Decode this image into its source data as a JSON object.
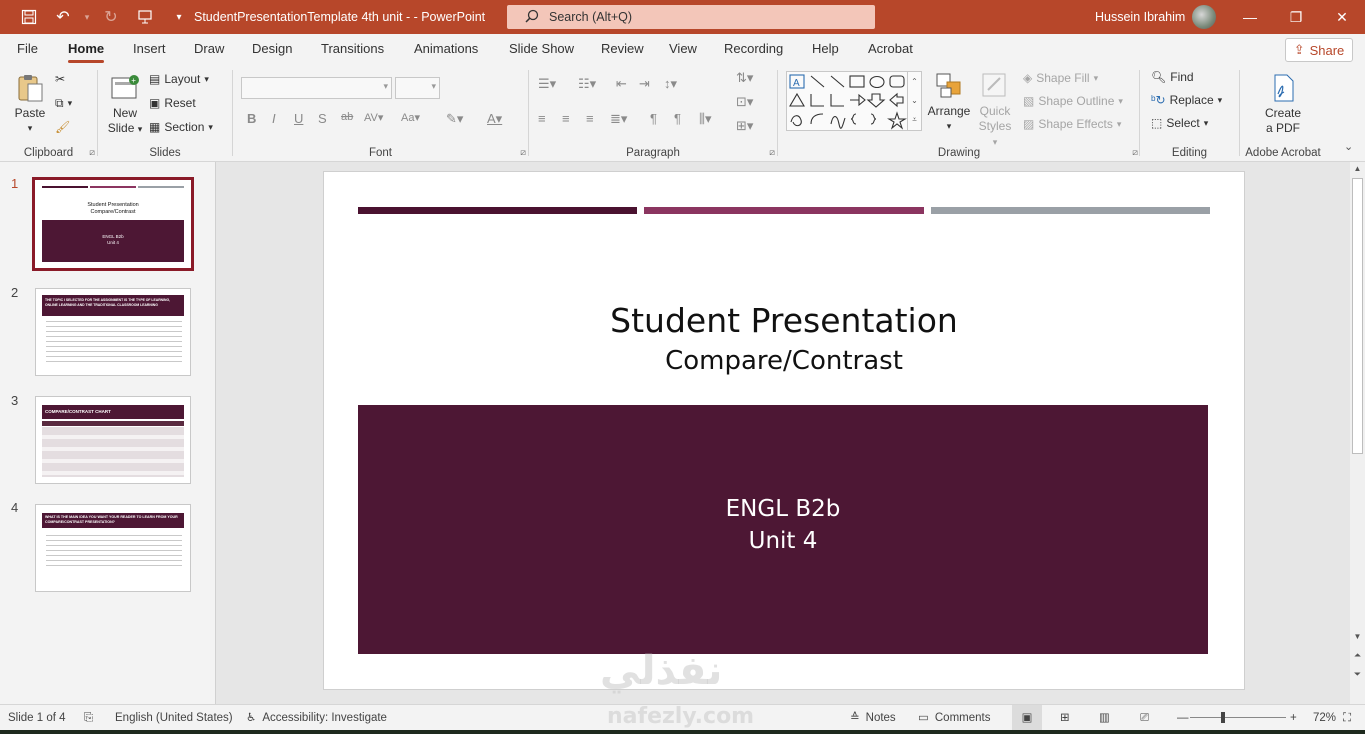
{
  "titlebar": {
    "doc_title": "StudentPresentationTemplate 4th unit -  -  PowerPoint",
    "search_placeholder": "Search (Alt+Q)",
    "user_name": "Hussein Ibrahim"
  },
  "tabs": [
    "File",
    "Home",
    "Insert",
    "Draw",
    "Design",
    "Transitions",
    "Animations",
    "Slide Show",
    "Review",
    "View",
    "Recording",
    "Help",
    "Acrobat"
  ],
  "share_label": "Share",
  "ribbon": {
    "clipboard": {
      "label": "Clipboard",
      "paste": "Paste"
    },
    "slides": {
      "label": "Slides",
      "new_slide_1": "New",
      "new_slide_2": "Slide",
      "layout": "Layout",
      "reset": "Reset",
      "section": "Section"
    },
    "font": {
      "label": "Font"
    },
    "paragraph": {
      "label": "Paragraph"
    },
    "drawing": {
      "label": "Drawing",
      "arrange": "Arrange",
      "quick_styles_1": "Quick",
      "quick_styles_2": "Styles",
      "shape_fill": "Shape Fill",
      "shape_outline": "Shape Outline",
      "shape_effects": "Shape Effects"
    },
    "editing": {
      "label": "Editing",
      "find": "Find",
      "replace": "Replace",
      "select": "Select"
    },
    "acrobat": {
      "label": "Adobe Acrobat",
      "create_pdf_1": "Create",
      "create_pdf_2": "a PDF"
    }
  },
  "thumbnails": [
    {
      "number": "1",
      "title": "Student Presentation",
      "subtitle": "Compare/Contrast",
      "box_line1": "ENGL B2b",
      "box_line2": "Unit 4"
    },
    {
      "number": "2",
      "header": "THE TOPIC I SELECTED FOR THE ASSIGNMENT IS THE TYPE OF LEARNING, ONLINE LEARNING AND THE TRADITIONAL CLASSROOM LEARNING"
    },
    {
      "number": "3",
      "header": "COMPARE/CONTRAST CHART"
    },
    {
      "number": "4",
      "header": "WHAT IS THE MAIN IDEA YOU WANT YOUR READER TO LEARN FROM YOUR COMPARE/CONTRAST PRESENTATION?"
    }
  ],
  "slide": {
    "title": "Student Presentation",
    "subtitle": "Compare/Contrast",
    "box_line1": "ENGL B2b",
    "box_line2": "Unit 4",
    "colors": {
      "bar1": "#4a1230",
      "bar2": "#8b3560",
      "bar3": "#9aa0a6",
      "box": "#4d1734"
    }
  },
  "status": {
    "slide_info": "Slide 1 of 4",
    "language": "English (United States)",
    "accessibility": "Accessibility: Investigate",
    "notes": "Notes",
    "comments": "Comments",
    "zoom": "72%",
    "zoom_level": 0.72
  },
  "watermark": {
    "arabic": "نفذلي",
    "latin": "nafezly.com"
  },
  "accent_color": "#b7472a"
}
